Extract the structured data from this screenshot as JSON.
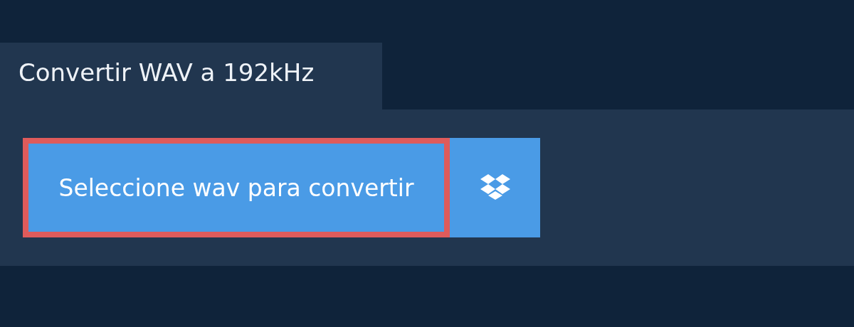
{
  "tab": {
    "title": "Convertir WAV a 192kHz"
  },
  "upload_button": {
    "label": "Seleccione wav para convertir"
  },
  "dropbox_button": {
    "kind": "dropbox"
  }
}
